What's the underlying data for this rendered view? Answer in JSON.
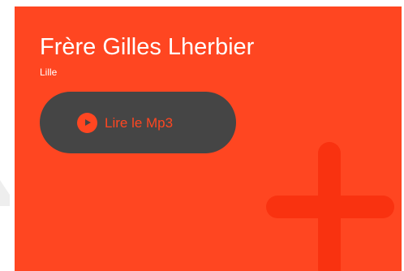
{
  "card": {
    "title": "Frère Gilles Lherbier",
    "subtitle": "Lille",
    "play_button_label": "Lire le Mp3",
    "play_icon": "play-icon",
    "decoration_icon": "plus-cross-icon"
  },
  "colors": {
    "card_background": "#ff4621",
    "button_background": "#454545",
    "accent": "#ff4621",
    "text": "#ffffff",
    "cross": "#f93210"
  }
}
